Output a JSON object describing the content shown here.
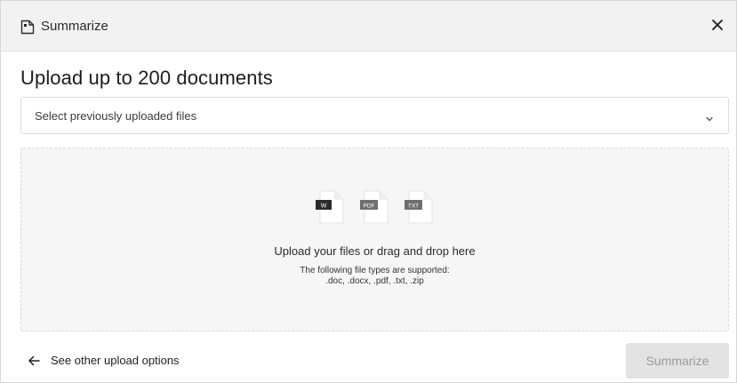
{
  "header": {
    "title": "Summarize",
    "icon": "document-icon",
    "close_icon": "close-icon"
  },
  "main": {
    "title": "Upload up to 200 documents",
    "select": {
      "placeholder": "Select previously uploaded files",
      "icon": "chevron-down-icon"
    },
    "dropzone": {
      "file_badges": [
        "W",
        "PDF",
        "TXT"
      ],
      "upload_link": "Upload your files",
      "upload_rest": " or drag and drop here",
      "supported_label": "The following file types are supported:",
      "supported_types": ".doc, .docx, .pdf, .txt, .zip"
    }
  },
  "footer": {
    "other_options": "See other upload options",
    "arrow_icon": "arrow-left-icon",
    "summarize_label": "Summarize",
    "summarize_disabled": true
  },
  "colors": {
    "header_bg": "#f2f2f2",
    "dropzone_bg": "#f6f6f6",
    "button_disabled_bg": "#e3e3e3",
    "button_disabled_text": "#9a9a9a"
  }
}
